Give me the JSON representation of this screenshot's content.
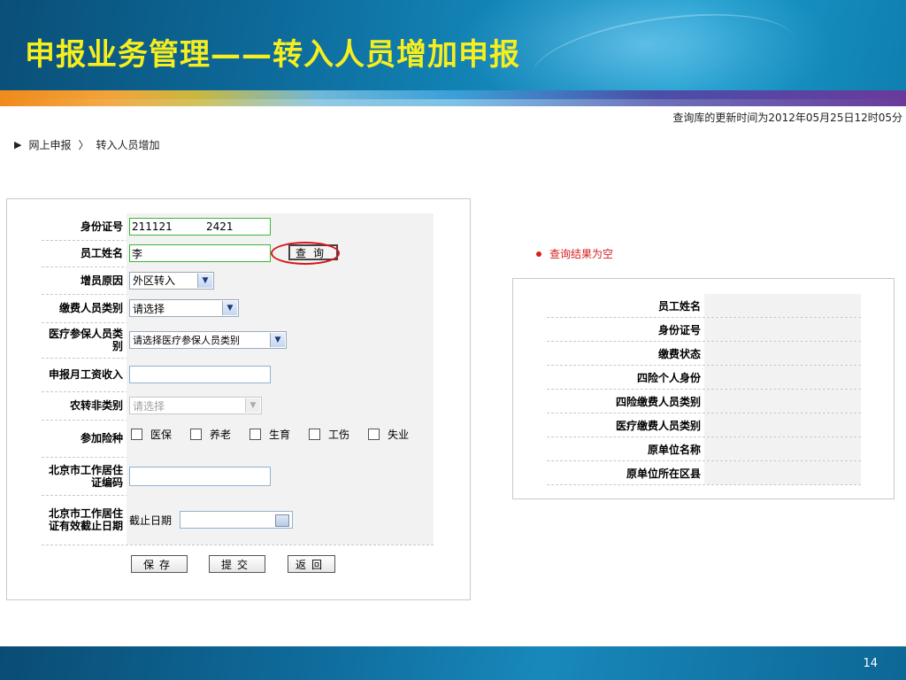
{
  "slide": {
    "title": "申报业务管理——转入人员增加申报",
    "page_number": "14"
  },
  "update_time": "查询库的更新时间为2012年05月25日12时05分",
  "breadcrumb": {
    "items": [
      "网上申报",
      "〉",
      "转入人员增加"
    ]
  },
  "form": {
    "id_label": "身份证号",
    "id_value": "211121          2421",
    "name_label": "员工姓名",
    "name_value": "李",
    "query_button": "查询",
    "reason_label": "增员原因",
    "reason_value": "外区转入",
    "payer_type_label": "缴费人员类别",
    "payer_type_value": "请选择",
    "medical_type_label": "医疗参保人员类别",
    "medical_type_value": "请选择医疗参保人员类别",
    "salary_label": "申报月工资收入",
    "salary_value": "",
    "rural_label": "农转非类别",
    "rural_value": "请选择",
    "insurance_label": "参加险种",
    "insurance_options": [
      "医保",
      "养老",
      "生育",
      "工伤",
      "失业"
    ],
    "permit_code_label": "北京市工作居住证编码",
    "permit_code_value": "",
    "permit_date_label": "北京市工作居住证有效截止日期",
    "deadline_text": "截止日期",
    "deadline_value": "",
    "buttons": {
      "save": "保存",
      "submit": "提交",
      "back": "返回"
    }
  },
  "result": {
    "message": "查询结果为空",
    "message_color": "#d81e1e",
    "fields": [
      "员工姓名",
      "身份证号",
      "缴费状态",
      "四险个人身份",
      "四险缴费人员类别",
      "医疗缴费人员类别",
      "原单位名称",
      "原单位所在区县"
    ]
  },
  "colors": {
    "title": "#f7ee1e",
    "highlight_ring": "#d8141c",
    "value_cell_bg": "#f2f2f2"
  }
}
